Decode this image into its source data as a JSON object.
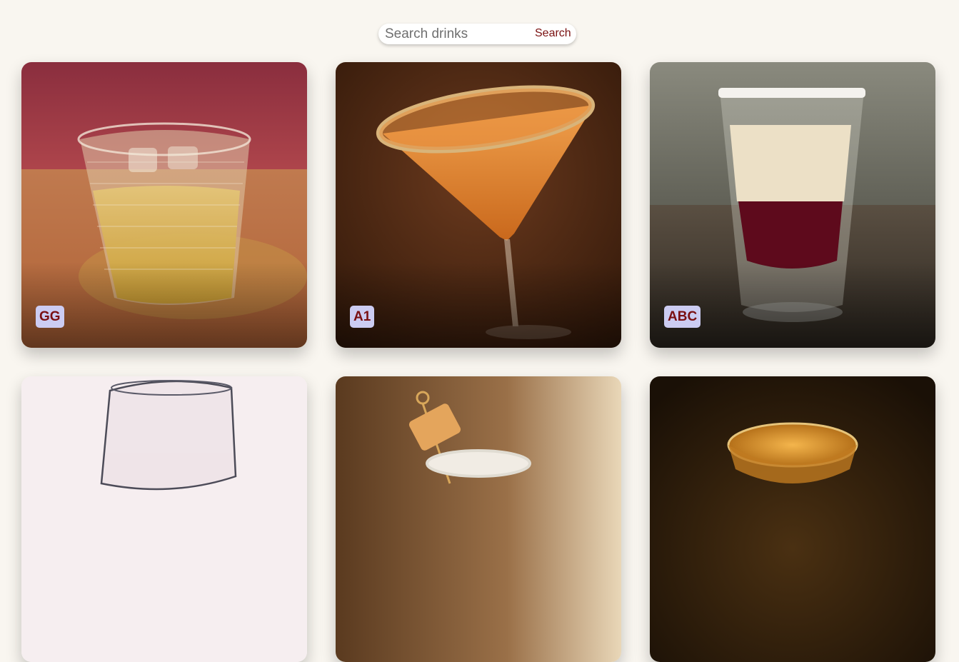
{
  "search": {
    "placeholder": "Search drinks",
    "value": "",
    "button_label": "Search"
  },
  "colors": {
    "page_background": "#f9f6f0",
    "accent": "#7a1010",
    "label_background": "#ccccf2"
  },
  "drinks": [
    {
      "label": "GG",
      "image": "rocks glass with ice and amber drink on a red backdrop"
    },
    {
      "label": "A1",
      "image": "orange martini with sugared rim"
    },
    {
      "label": "ABC",
      "image": "layered cream and red shot with salted rim"
    },
    {
      "label": "",
      "image": "empty clear wine glass on white"
    },
    {
      "label": "",
      "image": "small creamy shot with caramel cube on skewer"
    },
    {
      "label": "",
      "image": "amber drink in a shallow glass bowl on dark wood"
    }
  ]
}
